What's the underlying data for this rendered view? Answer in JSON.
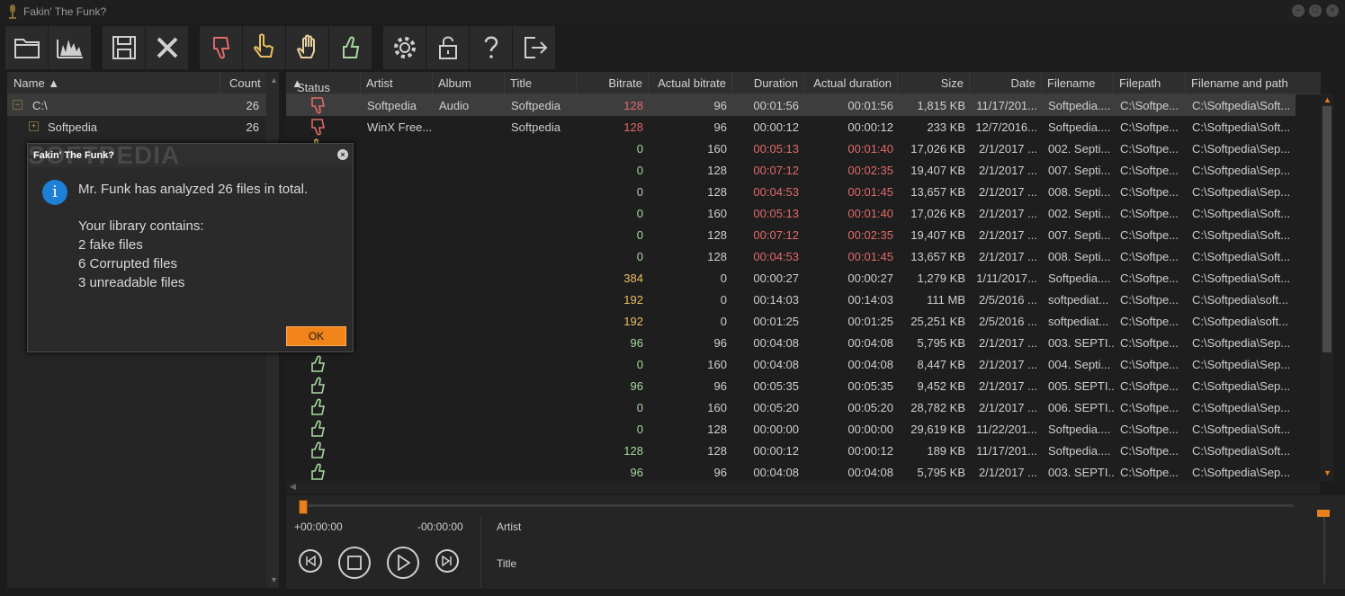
{
  "window": {
    "title": "Fakin' The Funk?"
  },
  "colors": {
    "accent": "#f08418",
    "fake": "#e06a6a",
    "corrupt": "#e8c060",
    "ok": "#a8d8a0",
    "info": "#1e7fd6"
  },
  "toolbar": {
    "groups": [
      [
        "open-folder-icon",
        "spectrum-icon"
      ],
      [
        "save-icon",
        "clear-icon"
      ],
      [
        "thumbs-down-icon",
        "hand-point-icon",
        "hand-stop-icon",
        "thumbs-up-icon"
      ],
      [
        "settings-icon",
        "unlock-icon",
        "help-icon",
        "exit-icon"
      ]
    ]
  },
  "tree": {
    "col_name": "Name",
    "col_count": "Count",
    "rows": [
      {
        "label": "C:\\",
        "count": "26",
        "expander": "−",
        "indent": 0
      },
      {
        "label": "Softpedia",
        "count": "26",
        "expander": "+",
        "indent": 1
      }
    ]
  },
  "grid": {
    "columns": [
      "Status",
      "Artist",
      "Album",
      "Title",
      "Bitrate",
      "Actual bitrate",
      "Duration",
      "Actual duration",
      "Size",
      "Date",
      "Filename",
      "Filepath",
      "Filename and path"
    ],
    "rows": [
      {
        "status": "fake",
        "artist": "Softpedia",
        "album": "Audio",
        "title": "Softpedia",
        "bitrate": "128",
        "actual_bitrate": "96",
        "duration": "00:01:56",
        "actual_duration": "00:01:56",
        "size": "1,815 KB",
        "date": "11/17/201...",
        "filename": "Softpedia....",
        "filepath": "C:\\Softpe...",
        "fullpath": "C:\\Softpedia\\Soft...",
        "br_color": "#e06a6a",
        "dur_color": "#cfcfcf"
      },
      {
        "status": "fake",
        "artist": "WinX Free...",
        "album": "",
        "title": "Softpedia",
        "bitrate": "128",
        "actual_bitrate": "96",
        "duration": "00:00:12",
        "actual_duration": "00:00:12",
        "size": "233 KB",
        "date": "12/7/2016...",
        "filename": "Softpedia....",
        "filepath": "C:\\Softpe...",
        "fullpath": "C:\\Softpedia\\Soft...",
        "br_color": "#e06a6a",
        "dur_color": "#cfcfcf"
      },
      {
        "status": "corrupt",
        "artist": "",
        "album": "",
        "title": "",
        "bitrate": "0",
        "actual_bitrate": "160",
        "duration": "00:05:13",
        "actual_duration": "00:01:40",
        "size": "17,026 KB",
        "date": "2/1/2017 ...",
        "filename": "002. Septi...",
        "filepath": "C:\\Softpe...",
        "fullpath": "C:\\Softpedia\\Sep...",
        "br_color": "#a8d8a0",
        "dur_color": "#e06a6a"
      },
      {
        "status": "corrupt",
        "artist": "",
        "album": "",
        "title": "",
        "bitrate": "0",
        "actual_bitrate": "128",
        "duration": "00:07:12",
        "actual_duration": "00:02:35",
        "size": "19,407 KB",
        "date": "2/1/2017 ...",
        "filename": "007. Septi...",
        "filepath": "C:\\Softpe...",
        "fullpath": "C:\\Softpedia\\Sep...",
        "br_color": "#a8d8a0",
        "dur_color": "#e06a6a"
      },
      {
        "status": "corrupt",
        "artist": "",
        "album": "",
        "title": "",
        "bitrate": "0",
        "actual_bitrate": "128",
        "duration": "00:04:53",
        "actual_duration": "00:01:45",
        "size": "13,657 KB",
        "date": "2/1/2017 ...",
        "filename": "008. Septi...",
        "filepath": "C:\\Softpe...",
        "fullpath": "C:\\Softpedia\\Sep...",
        "br_color": "#a8d8a0",
        "dur_color": "#e06a6a"
      },
      {
        "status": "corrupt",
        "artist": "",
        "album": "",
        "title": "",
        "bitrate": "0",
        "actual_bitrate": "160",
        "duration": "00:05:13",
        "actual_duration": "00:01:40",
        "size": "17,026 KB",
        "date": "2/1/2017 ...",
        "filename": "002. Septi...",
        "filepath": "C:\\Softpe...",
        "fullpath": "C:\\Softpedia\\Soft...",
        "br_color": "#a8d8a0",
        "dur_color": "#e06a6a"
      },
      {
        "status": "corrupt",
        "artist": "",
        "album": "",
        "title": "",
        "bitrate": "0",
        "actual_bitrate": "128",
        "duration": "00:07:12",
        "actual_duration": "00:02:35",
        "size": "19,407 KB",
        "date": "2/1/2017 ...",
        "filename": "007. Septi...",
        "filepath": "C:\\Softpe...",
        "fullpath": "C:\\Softpedia\\Soft...",
        "br_color": "#a8d8a0",
        "dur_color": "#e06a6a"
      },
      {
        "status": "corrupt",
        "artist": "",
        "album": "",
        "title": "",
        "bitrate": "0",
        "actual_bitrate": "128",
        "duration": "00:04:53",
        "actual_duration": "00:01:45",
        "size": "13,657 KB",
        "date": "2/1/2017 ...",
        "filename": "008. Septi...",
        "filepath": "C:\\Softpe...",
        "fullpath": "C:\\Softpedia\\Soft...",
        "br_color": "#a8d8a0",
        "dur_color": "#e06a6a"
      },
      {
        "status": "unreadable",
        "artist": "",
        "album": "",
        "title": "",
        "bitrate": "384",
        "actual_bitrate": "0",
        "duration": "00:00:27",
        "actual_duration": "00:00:27",
        "size": "1,279 KB",
        "date": "1/11/2017...",
        "filename": "Softpedia....",
        "filepath": "C:\\Softpe...",
        "fullpath": "C:\\Softpedia\\Soft...",
        "br_color": "#e8c060",
        "dur_color": "#cfcfcf"
      },
      {
        "status": "unreadable",
        "artist": "",
        "album": "",
        "title": "",
        "bitrate": "192",
        "actual_bitrate": "0",
        "duration": "00:14:03",
        "actual_duration": "00:14:03",
        "size": "111 MB",
        "date": "2/5/2016 ...",
        "filename": "softpediat...",
        "filepath": "C:\\Softpe...",
        "fullpath": "C:\\Softpedia\\soft...",
        "br_color": "#e8c060",
        "dur_color": "#cfcfcf"
      },
      {
        "status": "unreadable",
        "artist": "",
        "album": "",
        "title": "",
        "bitrate": "192",
        "actual_bitrate": "0",
        "duration": "00:01:25",
        "actual_duration": "00:01:25",
        "size": "25,251 KB",
        "date": "2/5/2016 ...",
        "filename": "softpediat...",
        "filepath": "C:\\Softpe...",
        "fullpath": "C:\\Softpedia\\soft...",
        "br_color": "#e8c060",
        "dur_color": "#cfcfcf"
      },
      {
        "status": "ok",
        "artist": "",
        "album": "",
        "title": "",
        "bitrate": "96",
        "actual_bitrate": "96",
        "duration": "00:04:08",
        "actual_duration": "00:04:08",
        "size": "5,795 KB",
        "date": "2/1/2017 ...",
        "filename": "003. SEPTI...",
        "filepath": "C:\\Softpe...",
        "fullpath": "C:\\Softpedia\\Sep...",
        "br_color": "#a8d8a0",
        "dur_color": "#cfcfcf"
      },
      {
        "status": "ok",
        "artist": "",
        "album": "",
        "title": "",
        "bitrate": "0",
        "actual_bitrate": "160",
        "duration": "00:04:08",
        "actual_duration": "00:04:08",
        "size": "8,447 KB",
        "date": "2/1/2017 ...",
        "filename": "004. Septi...",
        "filepath": "C:\\Softpe...",
        "fullpath": "C:\\Softpedia\\Sep...",
        "br_color": "#a8d8a0",
        "dur_color": "#cfcfcf"
      },
      {
        "status": "ok",
        "artist": "",
        "album": "",
        "title": "",
        "bitrate": "96",
        "actual_bitrate": "96",
        "duration": "00:05:35",
        "actual_duration": "00:05:35",
        "size": "9,452 KB",
        "date": "2/1/2017 ...",
        "filename": "005. SEPTI...",
        "filepath": "C:\\Softpe...",
        "fullpath": "C:\\Softpedia\\Sep...",
        "br_color": "#a8d8a0",
        "dur_color": "#cfcfcf"
      },
      {
        "status": "ok",
        "artist": "",
        "album": "",
        "title": "",
        "bitrate": "0",
        "actual_bitrate": "160",
        "duration": "00:05:20",
        "actual_duration": "00:05:20",
        "size": "28,782 KB",
        "date": "2/1/2017 ...",
        "filename": "006. SEPTI...",
        "filepath": "C:\\Softpe...",
        "fullpath": "C:\\Softpedia\\Sep...",
        "br_color": "#a8d8a0",
        "dur_color": "#cfcfcf"
      },
      {
        "status": "ok",
        "artist": "",
        "album": "",
        "title": "",
        "bitrate": "0",
        "actual_bitrate": "128",
        "duration": "00:00:00",
        "actual_duration": "00:00:00",
        "size": "29,619 KB",
        "date": "11/22/201...",
        "filename": "Softpedia....",
        "filepath": "C:\\Softpe...",
        "fullpath": "C:\\Softpedia\\Soft...",
        "br_color": "#a8d8a0",
        "dur_color": "#cfcfcf"
      },
      {
        "status": "ok",
        "artist": "",
        "album": "",
        "title": "",
        "bitrate": "128",
        "actual_bitrate": "128",
        "duration": "00:00:12",
        "actual_duration": "00:00:12",
        "size": "189 KB",
        "date": "11/17/201...",
        "filename": "Softpedia....",
        "filepath": "C:\\Softpe...",
        "fullpath": "C:\\Softpedia\\Soft...",
        "br_color": "#a8d8a0",
        "dur_color": "#cfcfcf"
      },
      {
        "status": "ok",
        "artist": "",
        "album": "",
        "title": "",
        "bitrate": "96",
        "actual_bitrate": "96",
        "duration": "00:04:08",
        "actual_duration": "00:04:08",
        "size": "5,795 KB",
        "date": "2/1/2017 ...",
        "filename": "003. SEPTI...",
        "filepath": "C:\\Softpe...",
        "fullpath": "C:\\Softpedia\\Sep...",
        "br_color": "#a8d8a0",
        "dur_color": "#cfcfcf"
      }
    ]
  },
  "player": {
    "elapsed": "+00:00:00",
    "remaining": "-00:00:00",
    "artist_label": "Artist",
    "title_label": "Title",
    "seek_position": 0,
    "volume": 1.0
  },
  "dialog": {
    "title": "Fakin' The Funk?",
    "watermark": "SOFTPEDIA",
    "lines": [
      "Mr. Funk has analyzed 26 files in total.",
      "Your library contains:",
      "2 fake files",
      "6 Corrupted files",
      "3 unreadable files"
    ],
    "ok_label": "OK"
  }
}
